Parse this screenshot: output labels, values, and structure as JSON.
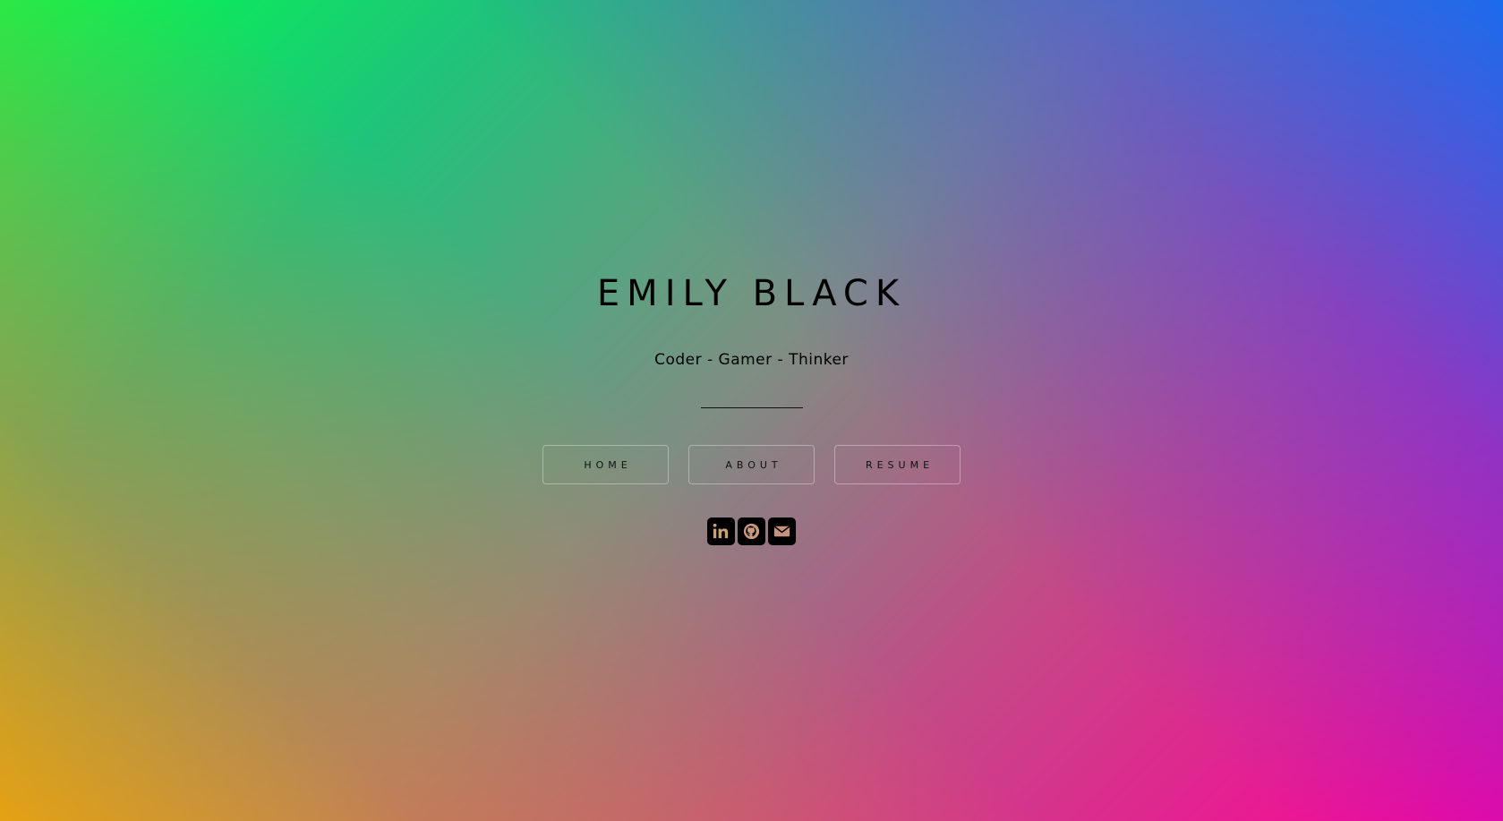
{
  "header": {
    "name": "EMILY BLACK",
    "tagline": "Coder - Gamer - Thinker"
  },
  "nav": {
    "items": [
      {
        "label": "HOME"
      },
      {
        "label": "ABOUT"
      },
      {
        "label": "RESUME"
      }
    ]
  },
  "social": {
    "icons": [
      "linkedin-icon",
      "github-icon",
      "email-icon"
    ]
  },
  "colors": {
    "top_left": "#00ff4a",
    "top_right": "#0066ff",
    "bottom_left": "#ffa000",
    "bottom_right": "#ff0099",
    "text": "#000000"
  }
}
